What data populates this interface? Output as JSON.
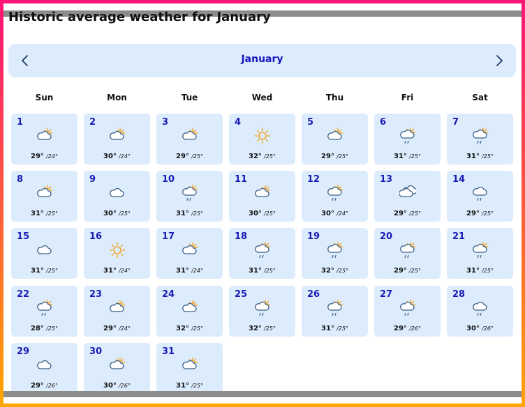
{
  "page_title": "Historic average weather for January",
  "month": "January",
  "weekdays": [
    "Sun",
    "Mon",
    "Tue",
    "Wed",
    "Thu",
    "Fri",
    "Sat"
  ],
  "days": [
    {
      "day": "1",
      "icon": "partly-cloudy-icon",
      "hi": "29°",
      "lo": "/24°"
    },
    {
      "day": "2",
      "icon": "partly-cloudy-icon",
      "hi": "30°",
      "lo": "/24°"
    },
    {
      "day": "3",
      "icon": "partly-cloudy-icon",
      "hi": "29°",
      "lo": "/25°"
    },
    {
      "day": "4",
      "icon": "sunny-icon",
      "hi": "32°",
      "lo": "/25°"
    },
    {
      "day": "5",
      "icon": "partly-cloudy-icon",
      "hi": "29°",
      "lo": "/25°"
    },
    {
      "day": "6",
      "icon": "partly-cloudy-rain-icon",
      "hi": "31°",
      "lo": "/25°"
    },
    {
      "day": "7",
      "icon": "partly-cloudy-rain-icon",
      "hi": "31°",
      "lo": "/25°"
    },
    {
      "day": "8",
      "icon": "partly-cloudy-icon",
      "hi": "31°",
      "lo": "/25°"
    },
    {
      "day": "9",
      "icon": "cloudy-icon",
      "hi": "30°",
      "lo": "/25°"
    },
    {
      "day": "10",
      "icon": "partly-cloudy-rain-icon",
      "hi": "31°",
      "lo": "/25°"
    },
    {
      "day": "11",
      "icon": "partly-cloudy-icon",
      "hi": "30°",
      "lo": "/25°"
    },
    {
      "day": "12",
      "icon": "partly-cloudy-rain-icon",
      "hi": "30°",
      "lo": "/24°"
    },
    {
      "day": "13",
      "icon": "overcast-icon",
      "hi": "29°",
      "lo": "/25°"
    },
    {
      "day": "14",
      "icon": "cloudy-rain-icon",
      "hi": "29°",
      "lo": "/25°"
    },
    {
      "day": "15",
      "icon": "cloudy-icon",
      "hi": "31°",
      "lo": "/25°"
    },
    {
      "day": "16",
      "icon": "sunny-icon",
      "hi": "31°",
      "lo": "/24°"
    },
    {
      "day": "17",
      "icon": "partly-cloudy-icon",
      "hi": "31°",
      "lo": "/24°"
    },
    {
      "day": "18",
      "icon": "partly-cloudy-rain-icon",
      "hi": "31°",
      "lo": "/25°"
    },
    {
      "day": "19",
      "icon": "partly-cloudy-rain-icon",
      "hi": "32°",
      "lo": "/25°"
    },
    {
      "day": "20",
      "icon": "partly-cloudy-rain-icon",
      "hi": "29°",
      "lo": "/25°"
    },
    {
      "day": "21",
      "icon": "partly-cloudy-rain-icon",
      "hi": "31°",
      "lo": "/25°"
    },
    {
      "day": "22",
      "icon": "partly-cloudy-rain-icon",
      "hi": "28°",
      "lo": "/25°"
    },
    {
      "day": "23",
      "icon": "partly-cloudy-icon",
      "hi": "29°",
      "lo": "/24°"
    },
    {
      "day": "24",
      "icon": "partly-cloudy-icon",
      "hi": "32°",
      "lo": "/25°"
    },
    {
      "day": "25",
      "icon": "partly-cloudy-rain-icon",
      "hi": "32°",
      "lo": "/25°"
    },
    {
      "day": "26",
      "icon": "partly-cloudy-rain-icon",
      "hi": "31°",
      "lo": "/25°"
    },
    {
      "day": "27",
      "icon": "partly-cloudy-rain-icon",
      "hi": "29°",
      "lo": "/26°"
    },
    {
      "day": "28",
      "icon": "cloudy-rain-icon",
      "hi": "30°",
      "lo": "/26°"
    },
    {
      "day": "29",
      "icon": "cloudy-icon",
      "hi": "29°",
      "lo": "/26°"
    },
    {
      "day": "30",
      "icon": "partly-cloudy-icon",
      "hi": "30°",
      "lo": "/26°"
    },
    {
      "day": "31",
      "icon": "partly-cloudy-icon",
      "hi": "31°",
      "lo": "/25°"
    }
  ],
  "colors": {
    "cell_bg": "#dcecfd",
    "day_number": "#1a1ab5",
    "month_label": "#1515c0",
    "sun": "#f5a623",
    "cloud_stroke": "#3a5f86",
    "rain": "#3a5f86"
  }
}
